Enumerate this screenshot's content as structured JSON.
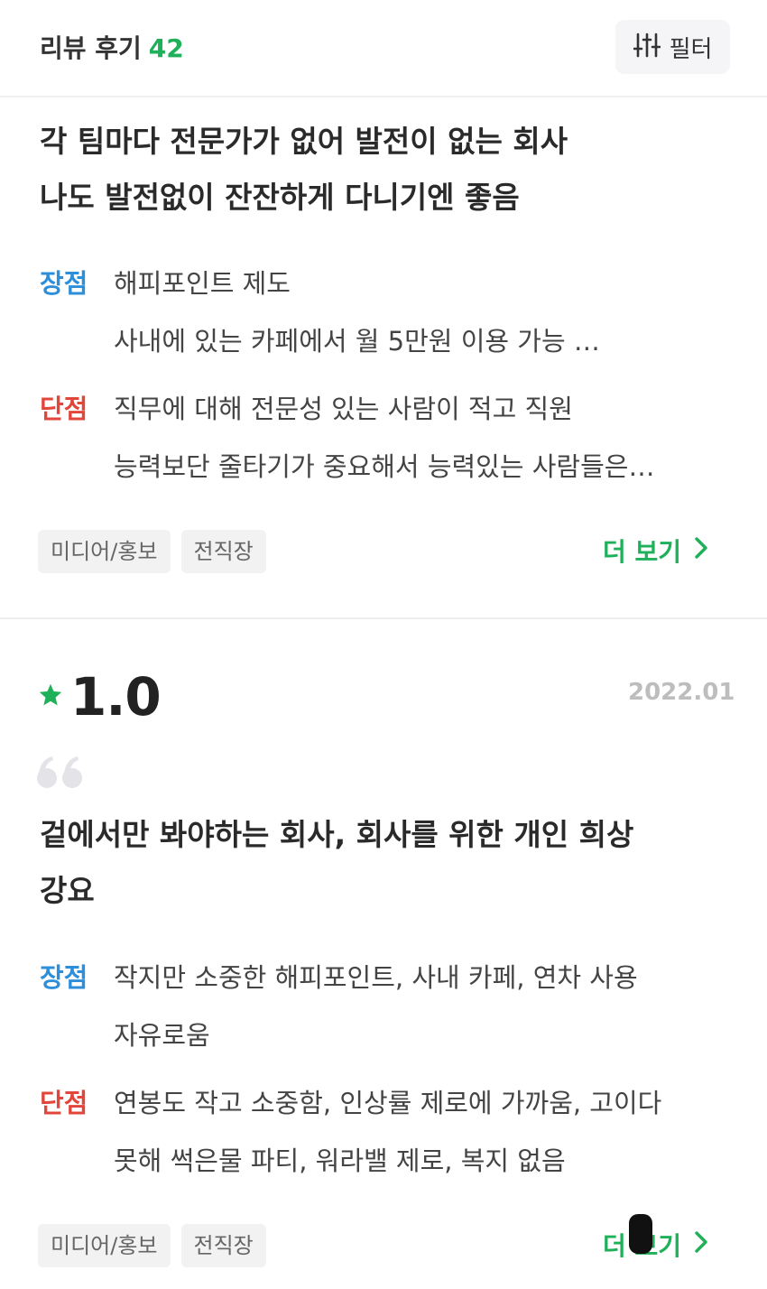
{
  "header": {
    "title": "리뷰 후기",
    "count": "42",
    "filter_label": "필터"
  },
  "reviews": [
    {
      "title_lines": [
        "각 팀마다 전문가가 없어 발전이 없는 회사",
        "나도 발전없이 잔잔하게 다니기엔 좋음"
      ],
      "pros_label": "장점",
      "pros_lines": [
        "해피포인트 제도",
        "사내에 있는 카페에서 월 5만원 이용 가능 …"
      ],
      "cons_label": "단점",
      "cons_lines": [
        "직무에 대해 전문성 있는 사람이 적고 직원",
        "능력보단 줄타기가 중요해서 능력있는 사람들은…"
      ],
      "tags": [
        "미디어/홍보",
        "전직장"
      ],
      "more_label": "더 보기"
    },
    {
      "rating": "1.0",
      "date": "2022.01",
      "title_lines": [
        "겉에서만 봐야하는 회사, 회사를 위한 개인 희상",
        "강요"
      ],
      "pros_label": "장점",
      "pros_lines": [
        "작지만 소중한 해피포인트, 사내 카페, 연차 사용",
        "자유로움"
      ],
      "cons_label": "단점",
      "cons_lines": [
        "연봉도 작고 소중함, 인상률 제로에 가까움, 고이다",
        "못해 썩은물 파티,  워라밸 제로, 복지 없음"
      ],
      "tags": [
        "미디어/홍보",
        "전직장"
      ],
      "more_label": "더 보기"
    }
  ],
  "colors": {
    "accent": "#1fb05a",
    "pros": "#2d8fd9",
    "cons": "#e2463b"
  },
  "icons": [
    "filter-sliders-icon",
    "chevron-right-icon",
    "star-icon",
    "quote-icon"
  ]
}
